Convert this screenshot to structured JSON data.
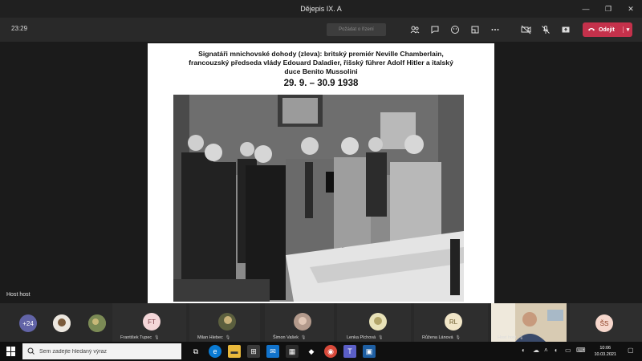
{
  "window": {
    "title": "Dějepis IX. A",
    "controls": [
      "—",
      "❐",
      "✕"
    ]
  },
  "toolbar": {
    "timer": "23:29",
    "share_request_label": "Požádat o řízení",
    "leave_label": "Odejít",
    "icons": [
      "participants-icon",
      "chat-icon",
      "reactions-icon",
      "rooms-icon",
      "more-icon",
      "camera-off-icon",
      "mic-off-icon",
      "share-icon",
      "phone-icon"
    ]
  },
  "slide": {
    "title_line1": "Signatáři mnichovské dohody (zleva): britský premiér Neville Chamberlain,",
    "title_line2": "francouzský předseda vlády Edouard Daladier, říšský führer Adolf Hitler a italský",
    "title_line3": "duce Benito Mussolini",
    "date": "29. 9. – 30.9 1938"
  },
  "stage": {
    "host_label": "Host host"
  },
  "participants": [
    {
      "kind": "count",
      "text": "+24",
      "color": "#6264a7"
    },
    {
      "kind": "photo",
      "text": "",
      "color": "#d9d2c8"
    },
    {
      "kind": "photo",
      "text": "",
      "color": "#6d7a4a"
    },
    {
      "kind": "initials",
      "text": "FT",
      "name": "František Tupec",
      "color": "#f3d6d8",
      "fg": "#7a3b44"
    },
    {
      "kind": "photo",
      "text": "",
      "name": "Milan Hlebec",
      "color": "#5b5f3e"
    },
    {
      "kind": "photo",
      "text": "",
      "name": "Šimon Vašek",
      "color": "#b39a8c"
    },
    {
      "kind": "photo",
      "text": "",
      "name": "Lenka Plchová",
      "color": "#e8e2b8"
    },
    {
      "kind": "initials",
      "text": "RL",
      "name": "Růžena Lánová",
      "color": "#f1e6c8",
      "fg": "#6b5a2a"
    },
    {
      "kind": "video",
      "text": "",
      "name": "Host host",
      "color": "#c9b79c"
    },
    {
      "kind": "initials",
      "text": "ŠS",
      "color": "#f6d7cc",
      "fg": "#8a3a1e"
    }
  ],
  "taskbar": {
    "search_placeholder": "Sem zadejte hledaný výraz",
    "time": "10:06",
    "date": "10.03.2021",
    "apps": [
      {
        "name": "task-view-icon",
        "glyph": "⧉",
        "color": "#101010"
      },
      {
        "name": "edge-icon",
        "glyph": "e",
        "color": "#0a7bd4"
      },
      {
        "name": "explorer-icon",
        "glyph": "▬",
        "color": "#e9b93b"
      },
      {
        "name": "store-icon",
        "glyph": "⊞",
        "color": "#3a3a3a"
      },
      {
        "name": "mail-icon",
        "glyph": "✉",
        "color": "#1173cc"
      },
      {
        "name": "calendar-icon",
        "glyph": "▦",
        "color": "#2b2b2b"
      },
      {
        "name": "dropbox-icon",
        "glyph": "◆",
        "color": "#101010"
      },
      {
        "name": "chrome-icon",
        "glyph": "◉",
        "color": "#d94a3b"
      },
      {
        "name": "teams-icon",
        "glyph": "T",
        "color": "#5b5fc7"
      },
      {
        "name": "photos-icon",
        "glyph": "▣",
        "color": "#1e5fa3"
      }
    ],
    "tray": [
      "network-icon",
      "cloud-icon",
      "volume-icon",
      "language-icon",
      "notifications-icon"
    ]
  }
}
